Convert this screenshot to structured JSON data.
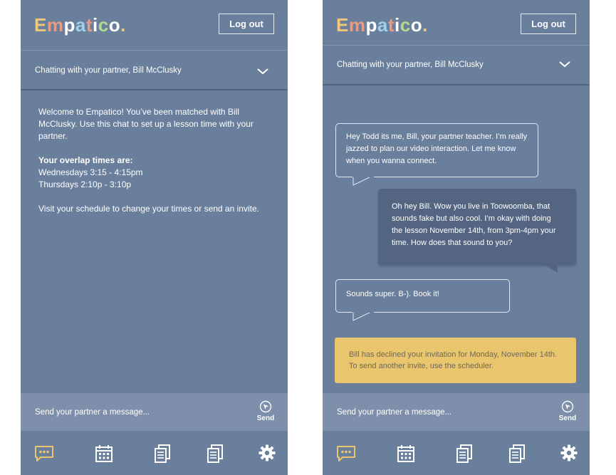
{
  "brand": {
    "letters": [
      "E",
      "m",
      "p",
      "a",
      "t",
      "i",
      "c",
      "o",
      "."
    ],
    "colors": [
      "#f1c77a",
      "#e89c86",
      "#ffffff",
      "#9fd0ea",
      "#e89c86",
      "#ffffff",
      "#b5d98a",
      "#ffffff",
      "#f1c77a"
    ]
  },
  "header": {
    "logout_label": "Log out"
  },
  "chat_header": {
    "title": "Chatting with your partner, Bill McClusky"
  },
  "welcome": {
    "intro": "Welcome to Empatico! You’ve been matched with Bill McClusky. Use this chat to set up a lesson time with your partner.",
    "overlap_label": "Your overlap times are:",
    "times": [
      "Wednesdays 3:15 - 4:15pm",
      "Thursdays 2:10p - 3:10p"
    ],
    "schedule_note": "Visit your schedule to change your times or send an invite."
  },
  "conversation": {
    "messages": [
      {
        "direction": "incoming",
        "text": "Hey Todd its me, Bill, your partner teacher. I’m really jazzed to plan our video interaction. Let me know when you wanna connect."
      },
      {
        "direction": "outgoing",
        "text": "Oh hey Bill. Wow you live in Toowoomba, that sounds fake but also cool. I’m okay with doing the lesson November 14th, from 3pm-4pm your time. How does that sound to you?"
      },
      {
        "direction": "incoming",
        "text": "Sounds super. B-). Book it!"
      }
    ],
    "alert": "Bill has declined your invitation for Monday, November 14th. To send another invite, use the scheduler."
  },
  "composer": {
    "placeholder": "Send your partner a message...",
    "send_label": "Send"
  },
  "nav": {
    "icons": [
      "chat-icon",
      "calendar-icon",
      "documents-icon",
      "documents-icon",
      "gear-icon"
    ],
    "active_color": "#e9c66e",
    "inactive_color": "#ffffff"
  }
}
